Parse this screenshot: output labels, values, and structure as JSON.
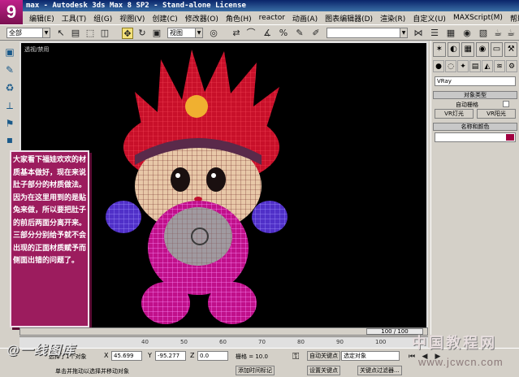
{
  "window": {
    "title": "max - Autodesk 3ds Max 8 SP2  - Stand-alone License",
    "badge": "9"
  },
  "menu": [
    "编辑(E)",
    "工具(T)",
    "组(G)",
    "视图(V)",
    "创建(C)",
    "修改器(O)",
    "角色(H)",
    "reactor",
    "动画(A)",
    "图表编辑器(D)",
    "渲染(R)",
    "自定义(U)",
    "MAXScript(M)",
    "帮助(H)"
  ],
  "toolbar": {
    "selection_filter": "全部",
    "reference_coord": "视图",
    "named_selection": ""
  },
  "viewport": {
    "label": "透视/禁用"
  },
  "right_panel": {
    "tabs": [
      "✶",
      "◐",
      "▦",
      "◉",
      "▭",
      "⚒"
    ],
    "renderer_select": "VRay",
    "object_type_title": "对象类型",
    "auto_grid_label": "自动栅格",
    "vr_light_button": "VR灯光",
    "vr_sun_button": "VR阳光",
    "name_color_title": "名称和颜色",
    "name_value": ""
  },
  "annotation": {
    "text": "大家看下福娃欢欢的材质基本做好，现在来说肚子部分的材质做法。因为在这里用到的是贴兔来做，所以要把肚子的前后两面分离开来。三部分分别给予就不会出现的正面材质赋予而侧面出错的问题了。"
  },
  "timeline": {
    "frame_display": "100 / 100",
    "progress": 1.0
  },
  "ruler_ticks": [
    "40",
    "50",
    "60",
    "70",
    "80",
    "90",
    "100"
  ],
  "status": {
    "selected_text": "选择了1个对象",
    "prompt_text": "单击并拖动以选择并移动对象",
    "x_value": "45.699",
    "y_value": "-95.277",
    "z_value": "0.0",
    "grid_text": "栅格 = 10.0",
    "add_time_tag": "添加时间标记",
    "auto_key": "自动关键点",
    "set_key": "设置关键点",
    "key_filter": "关键点过滤器...",
    "selected_object": "选定对象"
  },
  "watermarks": {
    "logo": "@一线图库",
    "site_cn": "中国教程网",
    "site_url": "www.jcwcn.com"
  },
  "colors": {
    "annotation_bg": "#9c1c5e",
    "titlebar": "#0a246a",
    "viewport_bg": "#000000"
  }
}
